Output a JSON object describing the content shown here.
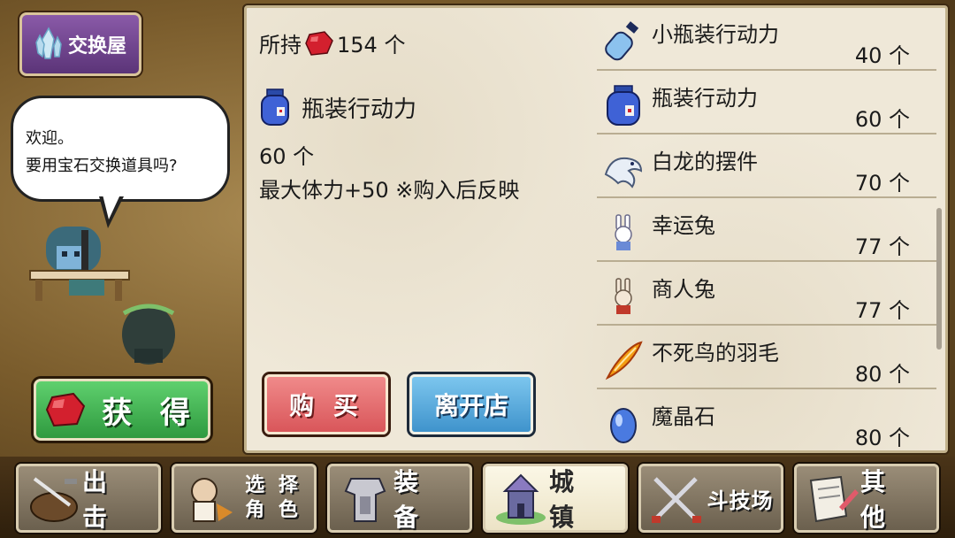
{
  "shop": {
    "title": "交换屋",
    "title_icon": "crystal-icon",
    "greeting_line1": "欢迎。",
    "greeting_line2": "要用宝石交换道具吗?",
    "get_button_label": "获 得",
    "get_button_icon": "gem-icon"
  },
  "detail": {
    "owned_label": "所持",
    "owned_count": "154 个",
    "owned_icon": "gem-icon",
    "selected_name": "瓶装行动力",
    "selected_icon": "potion-jar-icon",
    "selected_cost": "60 个",
    "selected_desc": "最大体力+50 ※购入后反映",
    "buy_label": "购 买",
    "leave_label": "离开店"
  },
  "items": [
    {
      "name": "小瓶装行动力",
      "price": "40 个",
      "icon": "small-vial-icon"
    },
    {
      "name": "瓶装行动力",
      "price": "60 个",
      "icon": "potion-jar-icon"
    },
    {
      "name": "白龙的摆件",
      "price": "70 个",
      "icon": "white-dragon-icon"
    },
    {
      "name": "幸运兔",
      "price": "77 个",
      "icon": "lucky-rabbit-icon"
    },
    {
      "name": "商人兔",
      "price": "77 个",
      "icon": "merchant-rabbit-icon"
    },
    {
      "name": "不死鸟的羽毛",
      "price": "80 个",
      "icon": "phoenix-feather-icon"
    },
    {
      "name": "魔晶石",
      "price": "80 个",
      "icon": "magic-crystal-icon"
    }
  ],
  "nav": [
    {
      "label": "出 击",
      "icon": "sortie-icon"
    },
    {
      "label_line1": "选 择",
      "label_line2": "角 色",
      "icon": "character-select-icon"
    },
    {
      "label": "装 备",
      "icon": "equipment-icon"
    },
    {
      "label": "城 镇",
      "icon": "town-icon",
      "active": true
    },
    {
      "label": "斗技场",
      "icon": "arena-icon"
    },
    {
      "label": "其 他",
      "icon": "other-icon"
    }
  ],
  "colors": {
    "panel_bg": "#efe8d8",
    "buy_button": "#d9565a",
    "leave_button": "#3f93cc",
    "get_button": "#2f9a3f",
    "title_bg": "#5b3478"
  }
}
